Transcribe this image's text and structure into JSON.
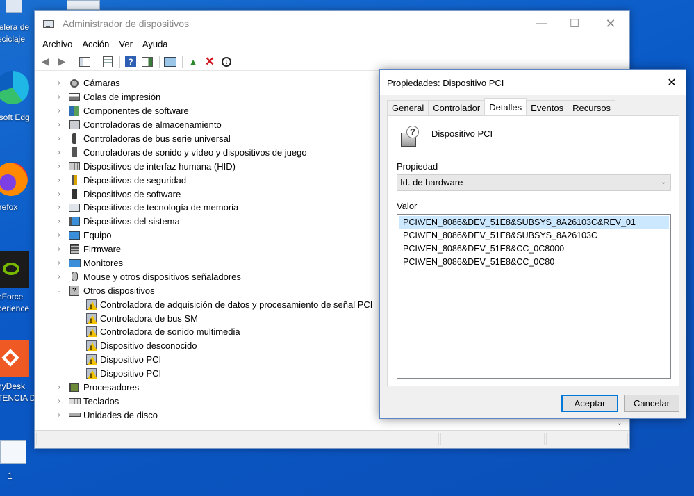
{
  "desktop": {
    "icons": [
      {
        "label_line1": "pelera de",
        "label_line2": "eciclaje"
      },
      {
        "label_line1": "osoft Edg"
      },
      {
        "label_line1": "irefox"
      },
      {
        "label_line1": "eForce",
        "label_line2": "perience"
      },
      {
        "label_line1": "nyDesk",
        "label_line2": "TENCIA D"
      },
      {
        "label_line1": "1"
      }
    ]
  },
  "device_manager": {
    "title": "Administrador de dispositivos",
    "menu": [
      "Archivo",
      "Acción",
      "Ver",
      "Ayuda"
    ],
    "categories": [
      {
        "label": "Cámaras",
        "icon": "camera-icon"
      },
      {
        "label": "Colas de impresión",
        "icon": "printer-icon"
      },
      {
        "label": "Componentes de software",
        "icon": "software-component-icon"
      },
      {
        "label": "Controladoras de almacenamiento",
        "icon": "storage-icon"
      },
      {
        "label": "Controladoras de bus serie universal",
        "icon": "usb-icon"
      },
      {
        "label": "Controladoras de sonido y vídeo y dispositivos de juego",
        "icon": "speaker-icon"
      },
      {
        "label": "Dispositivos de interfaz humana (HID)",
        "icon": "hid-icon"
      },
      {
        "label": "Dispositivos de seguridad",
        "icon": "security-icon"
      },
      {
        "label": "Dispositivos de software",
        "icon": "software-device-icon"
      },
      {
        "label": "Dispositivos de tecnología de memoria",
        "icon": "memory-icon"
      },
      {
        "label": "Dispositivos del sistema",
        "icon": "system-icon"
      },
      {
        "label": "Equipo",
        "icon": "computer-icon"
      },
      {
        "label": "Firmware",
        "icon": "firmware-icon"
      },
      {
        "label": "Monitores",
        "icon": "monitor-icon"
      },
      {
        "label": "Mouse y otros dispositivos señaladores",
        "icon": "mouse-icon"
      },
      {
        "label": "Otros dispositivos",
        "icon": "unknown-device-icon"
      }
    ],
    "other_devices": [
      "Controladora de adquisición de datos y procesamiento de señal PCI",
      "Controladora de bus SM",
      "Controladora de sonido multimedia",
      "Dispositivo desconocido",
      "Dispositivo PCI",
      "Dispositivo PCI"
    ],
    "categories_after": [
      {
        "label": "Procesadores",
        "icon": "processor-icon"
      },
      {
        "label": "Teclados",
        "icon": "keyboard-icon"
      },
      {
        "label": "Unidades de disco",
        "icon": "disk-icon"
      }
    ]
  },
  "dialog": {
    "title": "Propiedades: Dispositivo PCI",
    "tabs": [
      "General",
      "Controlador",
      "Detalles",
      "Eventos",
      "Recursos"
    ],
    "active_tab": "Detalles",
    "device_name": "Dispositivo PCI",
    "property_label": "Propiedad",
    "property_value": "Id. de hardware",
    "value_label": "Valor",
    "values": [
      "PCI\\VEN_8086&DEV_51E8&SUBSYS_8A26103C&REV_01",
      "PCI\\VEN_8086&DEV_51E8&SUBSYS_8A26103C",
      "PCI\\VEN_8086&DEV_51E8&CC_0C8000",
      "PCI\\VEN_8086&DEV_51E8&CC_0C80"
    ],
    "ok_label": "Aceptar",
    "cancel_label": "Cancelar"
  }
}
